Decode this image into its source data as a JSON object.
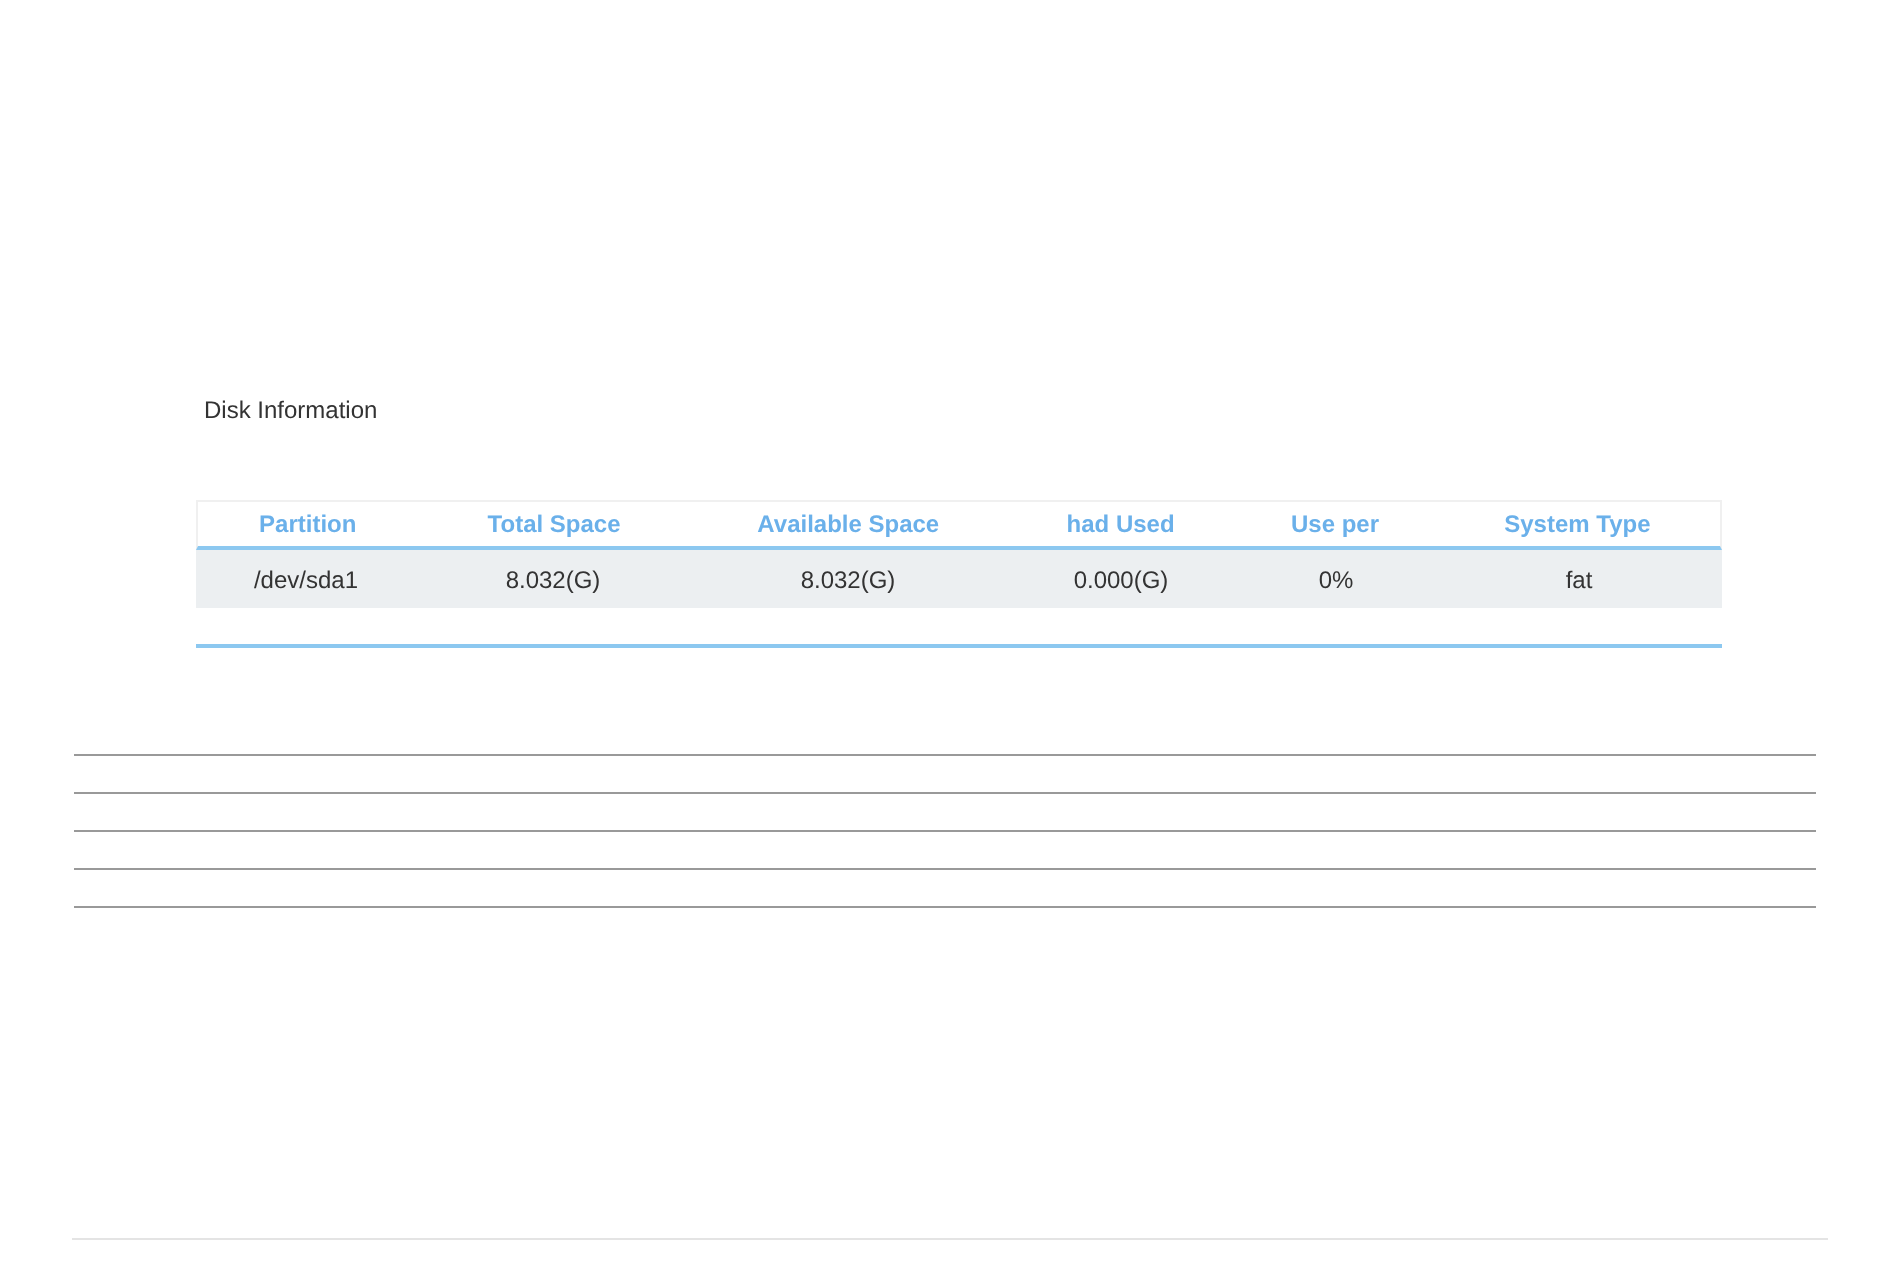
{
  "section_title": "Disk Information",
  "table": {
    "columns": [
      "Partition",
      "Total Space",
      "Available Space",
      "had Used",
      "Use per",
      "System Type"
    ],
    "rows": [
      [
        "/dev/sda1",
        "8.032(G)",
        "8.032(G)",
        "0.000(G)",
        "0%",
        "fat"
      ]
    ]
  }
}
